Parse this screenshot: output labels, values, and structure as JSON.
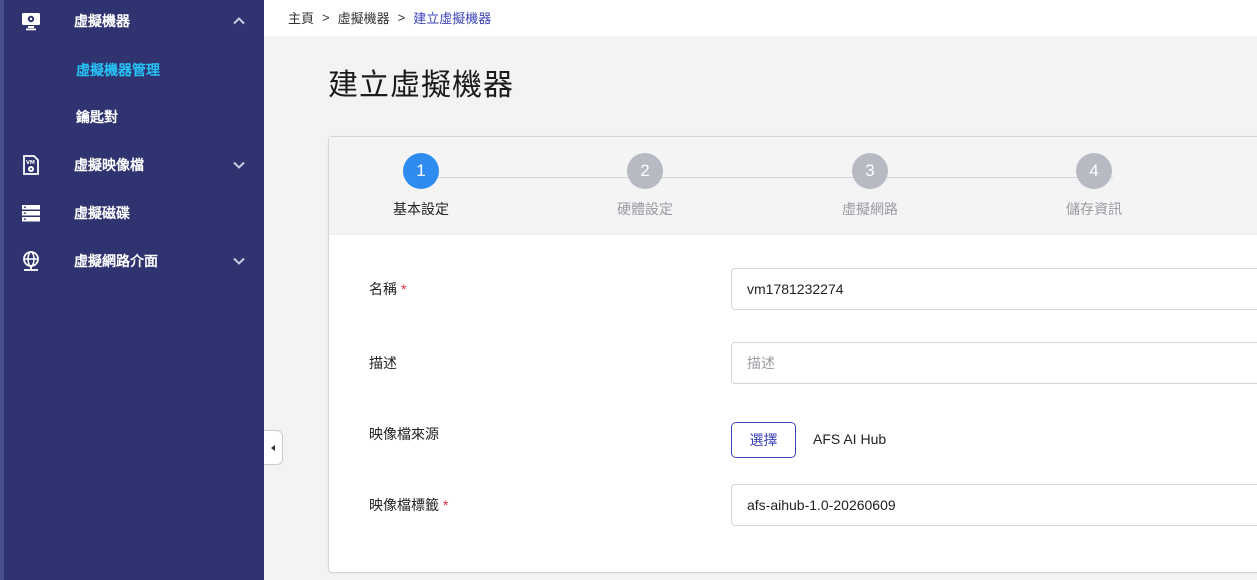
{
  "sidebar": {
    "items": [
      {
        "label": "虛擬機器",
        "icon": "monitor-icon",
        "chevron": "up"
      },
      {
        "label": "虛擬機器管理",
        "active": true
      },
      {
        "label": "鑰匙對"
      },
      {
        "label": "虛擬映像檔",
        "icon": "vm-image-icon",
        "chevron": "down"
      },
      {
        "label": "虛擬磁碟",
        "icon": "disk-stack-icon"
      },
      {
        "label": "虛擬網路介面",
        "icon": "network-globe-icon",
        "chevron": "down"
      }
    ]
  },
  "breadcrumb": {
    "home": "主頁",
    "separator": ">",
    "section": "虛擬機器",
    "current": "建立虛擬機器"
  },
  "page": {
    "title": "建立虛擬機器"
  },
  "stepper": {
    "steps": [
      {
        "number": "1",
        "label": "基本設定",
        "active": true
      },
      {
        "number": "2",
        "label": "硬體設定",
        "active": false
      },
      {
        "number": "3",
        "label": "虛擬網路",
        "active": false
      },
      {
        "number": "4",
        "label": "儲存資訊",
        "active": false
      }
    ]
  },
  "form": {
    "name": {
      "label": "名稱",
      "required_mark": "*",
      "value": "vm1781232274"
    },
    "description": {
      "label": "描述",
      "placeholder": "描述",
      "value": ""
    },
    "image_source": {
      "label": "映像檔來源",
      "button_label": "選擇",
      "value": "AFS AI Hub"
    },
    "image_tag": {
      "label": "映像檔標籤",
      "required_mark": "*",
      "value": "afs-aihub-1.0-20260609"
    }
  },
  "colors": {
    "sidebar_bg": "#2f3370",
    "active_nav": "#27c3f5",
    "step_active": "#2e8cf0",
    "step_inactive": "#b7b9c3",
    "brand": "#3c44b8",
    "required": "#e0303f"
  }
}
